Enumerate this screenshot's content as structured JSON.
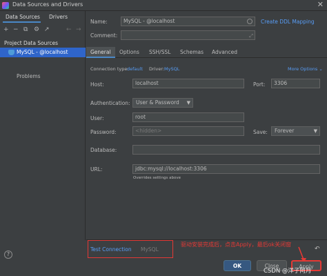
{
  "window": {
    "title": "Data Sources and Drivers",
    "close_glyph": "✕",
    "app_icon": "intellij-icon"
  },
  "left": {
    "tabs": [
      "Data Sources",
      "Drivers"
    ],
    "toolbar": [
      "+",
      "−",
      "⧉",
      "⚙",
      "↗",
      "←",
      "→"
    ],
    "section_title": "Project Data Sources",
    "datasource": "MySQL - @localhost",
    "problems": "Problems",
    "help": "?"
  },
  "form": {
    "name_label": "Name:",
    "name_value": "MySQL - @localhost",
    "create_ddl": "Create DDL Mapping",
    "comment_label": "Comment:",
    "tabs": [
      "General",
      "Options",
      "SSH/SSL",
      "Schemas",
      "Advanced"
    ],
    "conn_type_label": "Connection type:",
    "conn_type_value": "default",
    "driver_label": "Driver:",
    "driver_value": "MySQL",
    "more_options": "More Options",
    "host_label": "Host:",
    "host_value": "localhost",
    "port_label": "Port:",
    "port_value": "3306",
    "auth_label": "Authentication:",
    "auth_value": "User & Password",
    "user_label": "User:",
    "user_value": "root",
    "password_label": "Password:",
    "password_placeholder": "<hidden>",
    "save_label": "Save:",
    "save_value": "Forever",
    "database_label": "Database:",
    "url_label": "URL:",
    "url_value": "jdbc:mysql://localhost:3306",
    "overrides": "Overrides settings above"
  },
  "bottom": {
    "test_connection": "Test Connection",
    "test_driver": "MySQL",
    "annotation": "驱动安装完成后，点击Apply，最后ok关闭窗",
    "ok": "OK",
    "close": "Close",
    "apply": "Apply",
    "revert": "↶"
  },
  "watermark": "CSDN @洋子阿月",
  "colors": {
    "accent": "#4a88c7",
    "link": "#589df6",
    "annotation": "#e53935",
    "selection": "#2f65ca"
  }
}
